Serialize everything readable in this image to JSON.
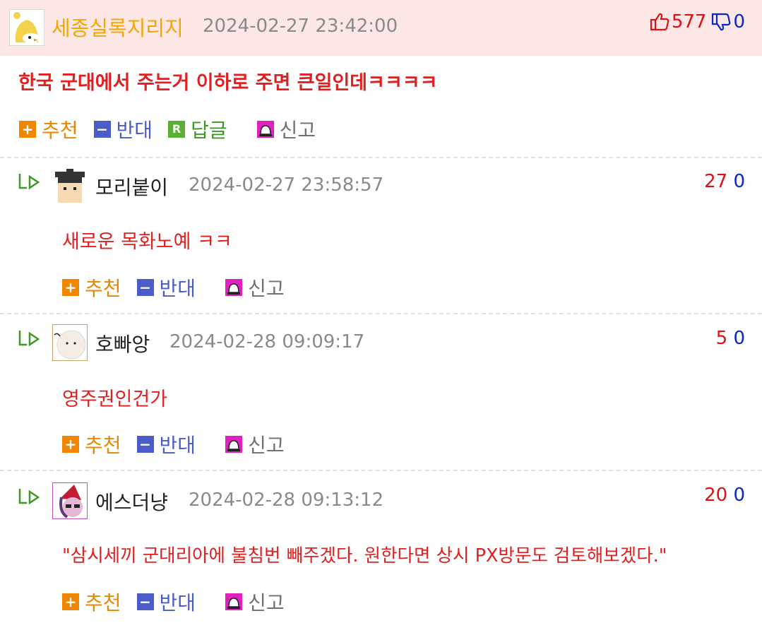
{
  "post": {
    "nick": "세종실록지리지",
    "date": "2024-02-27 23:42:00",
    "up": "577",
    "down": "0",
    "text": "한국 군대에서 주는거 이하로 주면 큰일인데ㅋㅋㅋㅋ"
  },
  "actions": {
    "recommend": "추천",
    "oppose": "반대",
    "reply": "답글",
    "report": "신고"
  },
  "comments": [
    {
      "nick": "모리붙이",
      "date": "2024-02-27 23:58:57",
      "up": "27",
      "down": "0",
      "text": "새로운 목화노예 ㅋㅋ"
    },
    {
      "nick": "호빠앙",
      "date": "2024-02-28 09:09:17",
      "up": "5",
      "down": "0",
      "text": "영주권인건가"
    },
    {
      "nick": "에스더냥",
      "date": "2024-02-28 09:13:12",
      "up": "20",
      "down": "0",
      "text": "\"삼시세끼 군대리아에 불침번 빼주겠다. 원한다면 상시 PX방문도 검토해보겠다.\""
    }
  ],
  "colors": {
    "header_bg": "#fde6e6",
    "accent_red": "#e02020",
    "nick_top": "#f0a800",
    "down_blue": "#0a28c8"
  }
}
